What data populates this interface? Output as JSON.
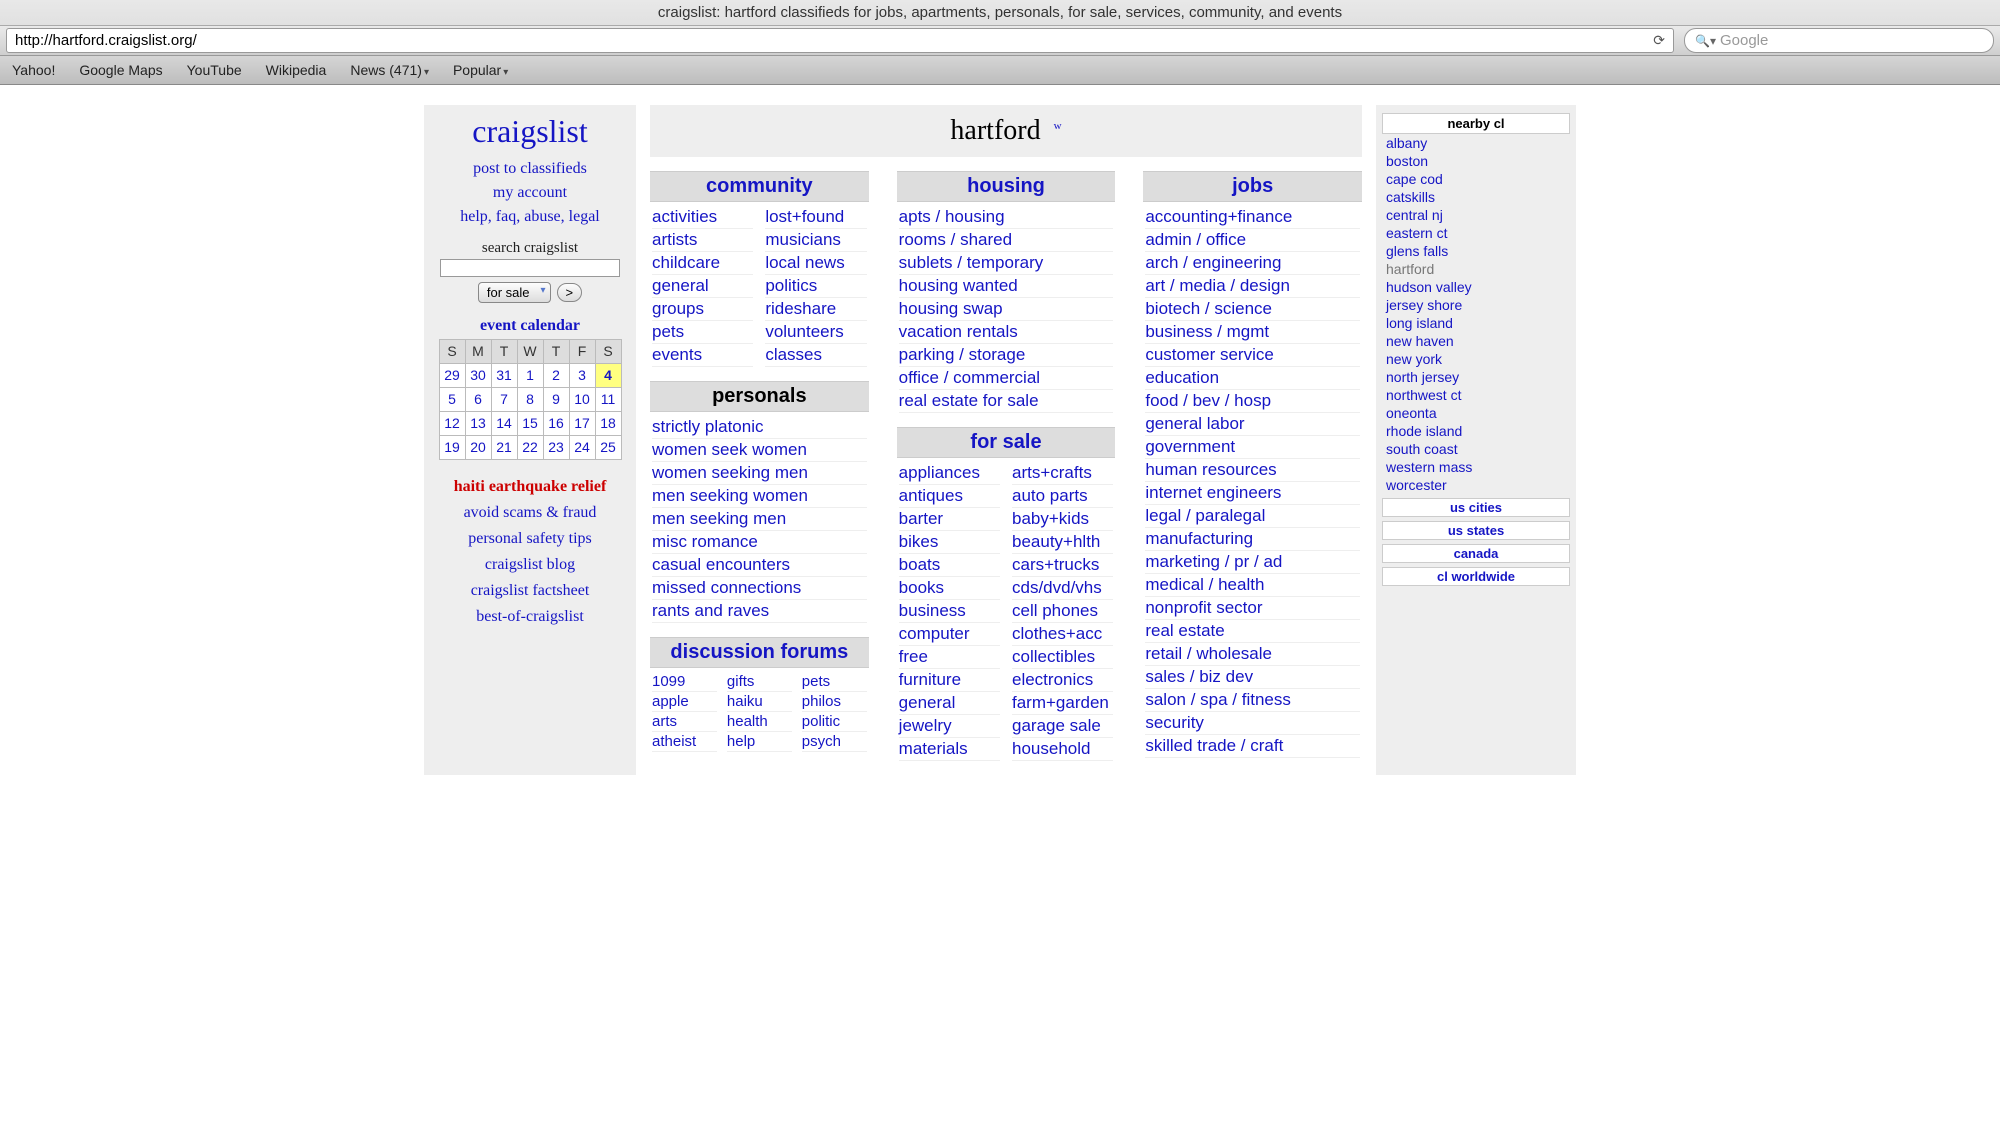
{
  "browser": {
    "title": "craigslist: hartford classifieds for jobs, apartments, personals, for sale, services, community, and events",
    "url": "http://hartford.craigslist.org/",
    "search_placeholder": "Google",
    "bookmarks": [
      "Yahoo!",
      "Google Maps",
      "YouTube",
      "Wikipedia",
      "News (471)",
      "Popular"
    ]
  },
  "left": {
    "logo": "craigslist",
    "links": [
      "post to classifieds",
      "my account",
      "help, faq, abuse, legal"
    ],
    "search_label": "search craigslist",
    "search_category": "for sale",
    "go": ">",
    "cal_title": "event calendar",
    "cal_days": [
      "S",
      "M",
      "T",
      "W",
      "T",
      "F",
      "S"
    ],
    "cal_rows": [
      [
        "29",
        "30",
        "31",
        "1",
        "2",
        "3",
        "4"
      ],
      [
        "5",
        "6",
        "7",
        "8",
        "9",
        "10",
        "11"
      ],
      [
        "12",
        "13",
        "14",
        "15",
        "16",
        "17",
        "18"
      ],
      [
        "19",
        "20",
        "21",
        "22",
        "23",
        "24",
        "25"
      ]
    ],
    "today": "4",
    "relief": "haiti earthquake relief",
    "footer": [
      "avoid scams & fraud",
      "personal safety tips",
      "craigslist blog",
      "craigslist factsheet",
      "best-of-craigslist"
    ]
  },
  "city": {
    "name": "hartford",
    "w": "w"
  },
  "community": {
    "head": "community",
    "left": [
      "activities",
      "artists",
      "childcare",
      "general",
      "groups",
      "pets",
      "events"
    ],
    "right": [
      "lost+found",
      "musicians",
      "local news",
      "politics",
      "rideshare",
      "volunteers",
      "classes"
    ]
  },
  "personals": {
    "head": "personals",
    "items": [
      "strictly platonic",
      "women seek women",
      "women seeking men",
      "men seeking women",
      "men seeking men",
      "misc romance",
      "casual encounters",
      "missed connections",
      "rants and raves"
    ]
  },
  "forums": {
    "head": "discussion forums",
    "c1": [
      "1099",
      "apple",
      "arts",
      "atheist"
    ],
    "c2": [
      "gifts",
      "haiku",
      "health",
      "help"
    ],
    "c3": [
      "pets",
      "philos",
      "politic",
      "psych"
    ]
  },
  "housing": {
    "head": "housing",
    "items": [
      "apts / housing",
      "rooms / shared",
      "sublets / temporary",
      "housing wanted",
      "housing swap",
      "vacation rentals",
      "parking / storage",
      "office / commercial",
      "real estate for sale"
    ]
  },
  "forsale": {
    "head": "for sale",
    "left": [
      "appliances",
      "antiques",
      "barter",
      "bikes",
      "boats",
      "books",
      "business",
      "computer",
      "free",
      "furniture",
      "general",
      "jewelry",
      "materials"
    ],
    "right": [
      "arts+crafts",
      "auto parts",
      "baby+kids",
      "beauty+hlth",
      "cars+trucks",
      "cds/dvd/vhs",
      "cell phones",
      "clothes+acc",
      "collectibles",
      "electronics",
      "farm+garden",
      "garage sale",
      "household"
    ]
  },
  "jobs": {
    "head": "jobs",
    "items": [
      "accounting+finance",
      "admin / office",
      "arch / engineering",
      "art / media / design",
      "biotech / science",
      "business / mgmt",
      "customer service",
      "education",
      "food / bev / hosp",
      "general labor",
      "government",
      "human resources",
      "internet engineers",
      "legal / paralegal",
      "manufacturing",
      "marketing / pr / ad",
      "medical / health",
      "nonprofit sector",
      "real estate",
      "retail / wholesale",
      "sales / biz dev",
      "salon / spa / fitness",
      "security",
      "skilled trade / craft"
    ]
  },
  "right": {
    "head": "nearby cl",
    "items": [
      "albany",
      "boston",
      "cape cod",
      "catskills",
      "central nj",
      "eastern ct",
      "glens falls",
      "hartford",
      "hudson valley",
      "jersey shore",
      "long island",
      "new haven",
      "new york",
      "north jersey",
      "northwest ct",
      "oneonta",
      "rhode island",
      "south coast",
      "western mass",
      "worcester"
    ],
    "current": "hartford",
    "others": [
      "us cities",
      "us states",
      "canada",
      "cl worldwide"
    ]
  }
}
